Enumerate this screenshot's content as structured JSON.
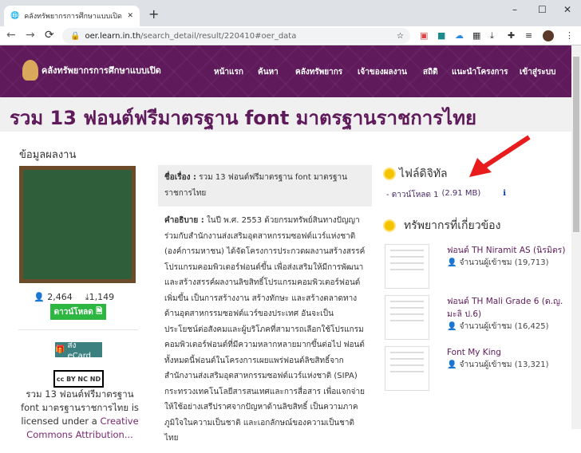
{
  "browser": {
    "tab_title": "คลังทรัพยากรการศึกษาแบบเปิด โครงการ",
    "url_host": "oer.learn.in.th",
    "url_path": "/search_detail/result/220410#oer_data"
  },
  "site": {
    "logo_text": "คลังทรัพยากรการศึกษาแบบเปิด",
    "menu": [
      "หน้าแรก",
      "ค้นหา",
      "คลังทรัพยากร",
      "เจ้าของผลงาน",
      "สถิติ",
      "แนะนำโครงการ",
      "เข้าสู่ระบบ"
    ]
  },
  "page_title": "รวม 13 ฟอนต์ฟรีมาตรฐาน font มาตรฐานราชการไทย",
  "left": {
    "heading": "ข้อมูลผลงาน",
    "views": "2,464",
    "downloads": "1,149",
    "download_button": "ดาวน์โหลด",
    "ecard_button": "ส่ง eCard",
    "cc_logo": "cc BY NC ND",
    "license_text": "รวม 13 ฟอนต์ฟรีมาตรฐาน font มาตรฐานราชการไทย is licensed under a ",
    "license_link": "Creative Commons Attribution..."
  },
  "middle": {
    "title_label": "ชื่อเรื่อง :",
    "title_value": "รวม 13 ฟอนต์ฟรีมาตรฐาน font มาตรฐานราชการไทย",
    "desc_label": "คำอธิบาย :",
    "desc_value": "ในปี พ.ศ. 2553 ด้วยกรมทรัพย์สินทางปัญญา ร่วมกับสำนักงานส่งเสริมอุตสาหกรรมซอฟต์แวร์แห่งชาติ (องค์การมหาชน) ได้จัดโครงการประกวดผลงานสร้างสรรค์โปรแกรมคอมพิวเตอร์ฟอนต์ขึ้น เพื่อส่งเสริมให้มีการพัฒนาและสร้างสรรค์ผลงานลิขสิทธิ์โปรแกรมคอมพิวเตอร์ฟอนต์เพิ่มขึ้น เป็นการสร้างงาน สร้างทักษะ และสร้างตลาดทางด้านอุตสาหกรรมซอฟต์แวร์ของประเทศ อันจะเป็นประโยชน์ต่อสังคมและผู้บริโภคที่สามารถเลือกใช้โปรแกรมคอมพิวเตอร์ฟอนต์ที่มีความหลากหลายมากขึ้นต่อไป ฟอนต์ทั้งหมดนี้ฟอนต์ในโครงการเผยแพร่ฟอนต์ลิขสิทธิ์จากสำนักงานส่งเสริมอุตสาหกรรมซอฟต์แวร์แห่งชาติ (SIPA) กระทรวงเทคโนโลยีสารสนเทศและการสื่อสาร เพื่อแจกจ่ายให้ใช้อย่างเสรีปราศจากปัญหาด้านลิขสิทธิ์ เป็นความภาคภูมิใจในความเป็นชาติ และเอกลักษณ์ของความเป็นชาติไทย"
  },
  "right": {
    "digital_heading": "ไฟล์ดิจิทัล",
    "download_link": "- ดาวน์โหลด 1",
    "download_size": "(2.91 MB)",
    "related_heading": "ทรัพยากรที่เกี่ยวข้อง",
    "related": [
      {
        "title": "ฟอนต์ TH Niramit AS (นิรมิตร)",
        "views": "จำนวนผู้เข้าชม (19,713)"
      },
      {
        "title": "ฟอนต์ TH Mali Grade 6 (ด.ญ. มะลิ ป.6)",
        "views": "จำนวนผู้เข้าชม (16,425)"
      },
      {
        "title": "Font My King",
        "views": "จำนวนผู้เข้าชม (13,321)"
      }
    ]
  },
  "colors": {
    "brand": "#5e1a5a",
    "download": "#2db640",
    "ecard": "#3d8080",
    "arrow": "#e81c1c"
  }
}
